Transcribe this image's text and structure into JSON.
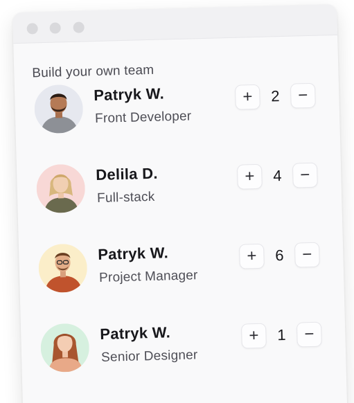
{
  "window": {
    "controls": [
      "window-dot-icon",
      "window-dot-icon",
      "window-dot-icon"
    ]
  },
  "heading": "Build your own team",
  "members": [
    {
      "name": "Patryk W.",
      "role": "Front Developer",
      "count": "2",
      "plus_label": "+",
      "minus_label": "−",
      "avatar_bg": "#e6e8ef"
    },
    {
      "name": "Delila D.",
      "role": "Full-stack",
      "count": "4",
      "plus_label": "+",
      "minus_label": "−",
      "avatar_bg": "#f8d8d6"
    },
    {
      "name": "Patryk W.",
      "role": "Project Manager",
      "count": "6",
      "plus_label": "+",
      "minus_label": "−",
      "avatar_bg": "#fbeec9"
    },
    {
      "name": "Patryk W.",
      "role": "Senior Designer",
      "count": "1",
      "plus_label": "+",
      "minus_label": "−",
      "avatar_bg": "#d6f0df"
    }
  ],
  "colors": {
    "card_bg": "#f9f9fa",
    "titlebar_bg": "#f1f1f3",
    "window_dot": "#d9d9dc",
    "text_primary": "#17171b",
    "text_secondary": "#4e4e56"
  }
}
